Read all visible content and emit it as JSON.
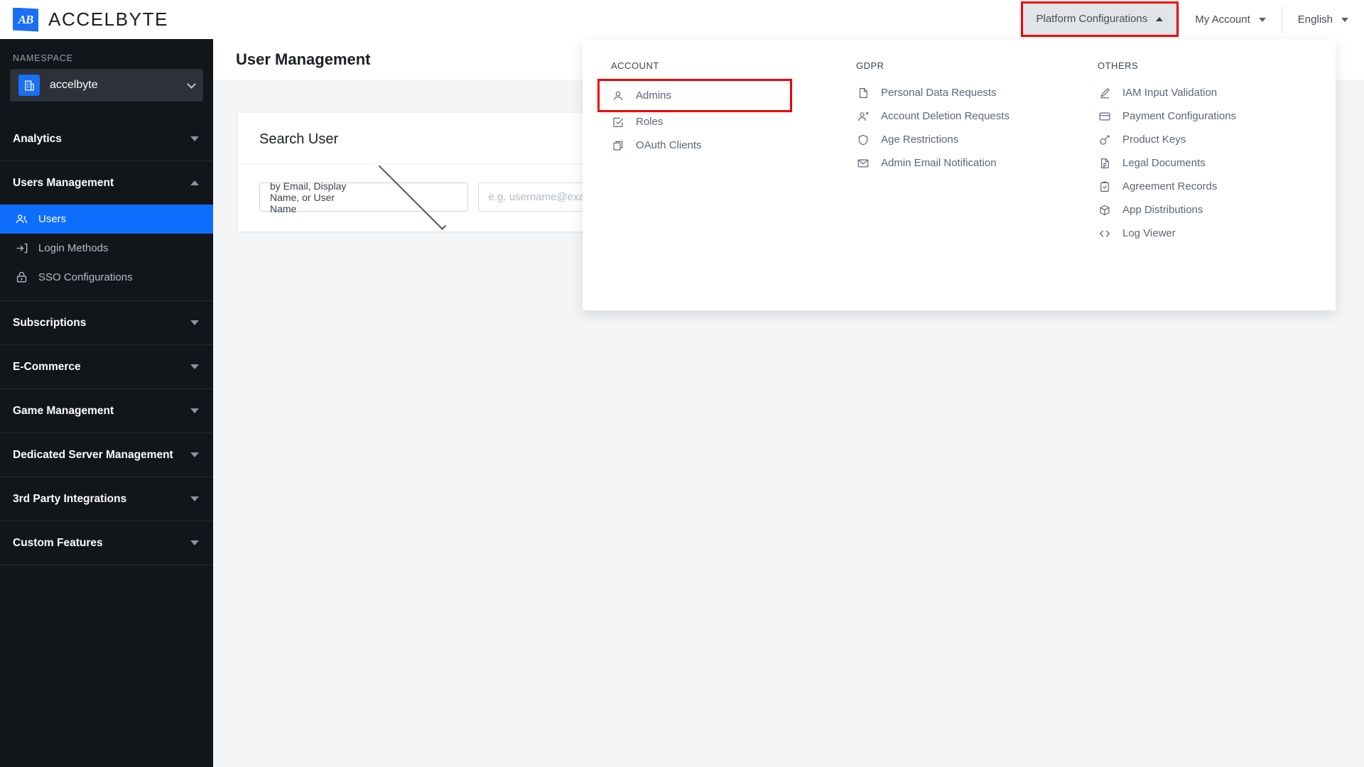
{
  "header": {
    "logo_text": "ACCELBYTE",
    "logo_mark": "AB",
    "menus": [
      {
        "label": "Platform Configurations",
        "state": "open",
        "icon": "chevron-up-icon"
      },
      {
        "label": "My Account",
        "state": "closed",
        "icon": "chevron-down-icon"
      },
      {
        "label": "English",
        "state": "closed",
        "icon": "chevron-down-icon"
      }
    ]
  },
  "sidebar": {
    "namespace_label": "NAMESPACE",
    "namespace_value": "accelbyte",
    "namespace_icon": "building-icon",
    "groups": [
      {
        "title": "Analytics",
        "expanded": false,
        "items": []
      },
      {
        "title": "Users Management",
        "expanded": true,
        "items": [
          {
            "label": "Users",
            "icon": "users-icon",
            "selected": true
          },
          {
            "label": "Login Methods",
            "icon": "login-arrow-icon",
            "selected": false
          },
          {
            "label": "SSO Configurations",
            "icon": "lock-icon",
            "selected": false
          }
        ]
      },
      {
        "title": "Subscriptions",
        "expanded": false,
        "items": []
      },
      {
        "title": "E-Commerce",
        "expanded": false,
        "items": []
      },
      {
        "title": "Game Management",
        "expanded": false,
        "items": []
      },
      {
        "title": "Dedicated Server Management",
        "expanded": false,
        "items": []
      },
      {
        "title": "3rd Party Integrations",
        "expanded": false,
        "items": []
      },
      {
        "title": "Custom Features",
        "expanded": false,
        "items": []
      }
    ]
  },
  "main": {
    "page_title": "User Management",
    "card": {
      "title": "Search User",
      "select_value": "by Email, Display Name, or User Name",
      "input_value": "",
      "input_placeholder": "e.g. username@example.com"
    }
  },
  "mega_menu": {
    "columns": [
      {
        "heading": "ACCOUNT",
        "items": [
          {
            "label": "Admins",
            "icon": "person-icon",
            "highlighted": true
          },
          {
            "label": "Roles",
            "icon": "checkbox-icon",
            "highlighted": false
          },
          {
            "label": "OAuth Clients",
            "icon": "copy-icon",
            "highlighted": false
          }
        ]
      },
      {
        "heading": "GDPR",
        "items": [
          {
            "label": "Personal Data Requests",
            "icon": "file-icon",
            "highlighted": false
          },
          {
            "label": "Account Deletion Requests",
            "icon": "person-remove-icon",
            "highlighted": false
          },
          {
            "label": "Age Restrictions",
            "icon": "shield-icon",
            "highlighted": false
          },
          {
            "label": "Admin Email Notification",
            "icon": "envelope-icon",
            "highlighted": false
          }
        ]
      },
      {
        "heading": "OTHERS",
        "items": [
          {
            "label": "IAM Input Validation",
            "icon": "pencil-icon",
            "highlighted": false
          },
          {
            "label": "Payment Configurations",
            "icon": "credit-card-icon",
            "highlighted": false
          },
          {
            "label": "Product Keys",
            "icon": "key-icon",
            "highlighted": false
          },
          {
            "label": "Legal Documents",
            "icon": "document-text-icon",
            "highlighted": false
          },
          {
            "label": "Agreement Records",
            "icon": "clipboard-check-icon",
            "highlighted": false
          },
          {
            "label": "App Distributions",
            "icon": "box-icon",
            "highlighted": false
          },
          {
            "label": "Log Viewer",
            "icon": "code-brackets-icon",
            "highlighted": false
          }
        ]
      }
    ]
  },
  "colors": {
    "accent_blue": "#0d6efd",
    "sidebar_bg": "#121519",
    "highlight_red": "#f20000",
    "page_bg": "#f4f5f7"
  }
}
